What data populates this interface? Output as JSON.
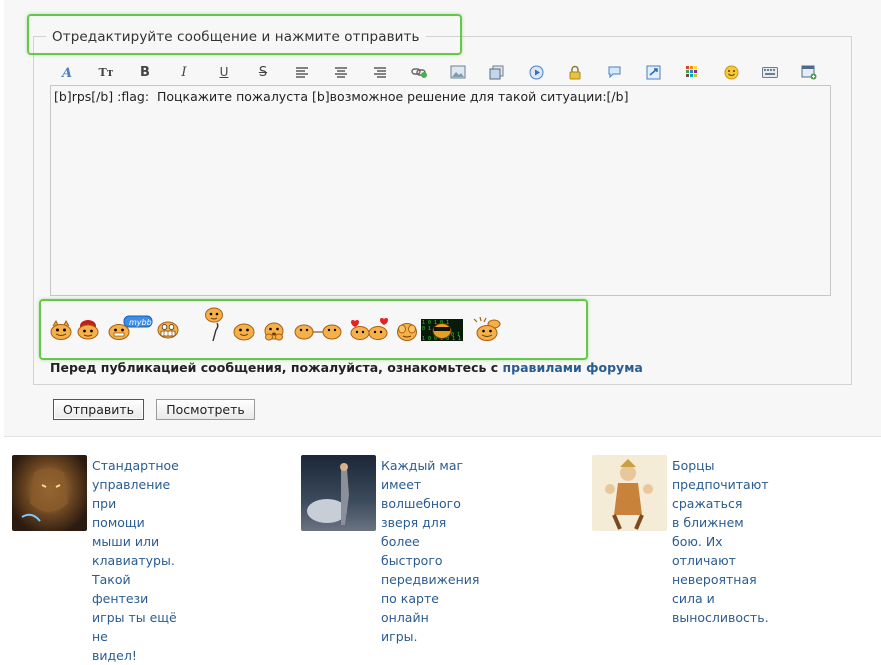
{
  "form": {
    "legend": "Отредактируйте сообщение и нажмите отправить",
    "message": "[b]rps[/b] :flag:  Поцкажите пожалуста [b]возможное решение для такой ситуации:[/b]",
    "rules_prefix": "Перед публикацией сообщения, пожалуйста, ознакомьтесь с ",
    "rules_link": "правилами форума",
    "submit_label": "Отправить",
    "preview_label": "Посмотреть"
  },
  "toolbar": {
    "buttons": [
      {
        "icon": "font-icon"
      },
      {
        "icon": "font-size-icon",
        "text": "Tт"
      },
      {
        "icon": "bold-icon",
        "text": "B"
      },
      {
        "icon": "italic-icon",
        "text": "I"
      },
      {
        "icon": "underline-icon",
        "text": "U"
      },
      {
        "icon": "strikethrough-icon",
        "text": "S"
      },
      {
        "icon": "align-left-icon"
      },
      {
        "icon": "align-center-icon"
      },
      {
        "icon": "align-right-icon"
      },
      {
        "icon": "link-icon"
      },
      {
        "icon": "image-icon"
      },
      {
        "icon": "copy-icon"
      },
      {
        "icon": "video-icon"
      },
      {
        "icon": "hide-lock-icon"
      },
      {
        "icon": "quote-bubble-icon"
      },
      {
        "icon": "spoiler-icon"
      },
      {
        "icon": "color-palette-icon"
      },
      {
        "icon": "smiley-icon"
      },
      {
        "icon": "keyboard-icon"
      },
      {
        "icon": "add-table-icon"
      }
    ]
  },
  "smilies": [
    {
      "icon": "smiley-horns-icon"
    },
    {
      "icon": "smiley-hat-icon"
    },
    {
      "icon": "smiley-mybb-icon",
      "text": "mybb"
    },
    {
      "icon": "smiley-grin-icon"
    },
    {
      "icon": "smiley-cane-icon"
    },
    {
      "icon": "smiley-plain-icon"
    },
    {
      "icon": "smiley-hands-icon"
    },
    {
      "icon": "smiley-pair-icon"
    },
    {
      "icon": "smiley-love-icon"
    },
    {
      "icon": "smiley-hide-icon"
    },
    {
      "icon": "smiley-matrix-icon"
    },
    {
      "icon": "smiley-wave-icon"
    }
  ],
  "ads": [
    {
      "text": "Стандартное управление при помощи мыши или клавиатуры. Такой фентези игры ты ещё не видел!",
      "lines": [
        "Стандартное управление при",
        "помощи мыши или клавиатуры.",
        "Такой фентези игры ты ещё не",
        "видел!"
      ]
    },
    {
      "text": "Каждый маг имеет волшебного зверя для более быстрого передвижения по карте онлайн игры.",
      "lines": [
        "Каждый маг имеет волшебного",
        "зверя для более быстрого",
        "передвижения по карте онлайн",
        "игры."
      ]
    },
    {
      "text": "Борцы предпочитают сражаться в ближнем бою. Их отличают невероятная сила и выносливость.",
      "lines": [
        "Борцы предпочитают сражаться",
        "в ближнем бою. Их отличают",
        "невероятная сила и",
        "выносливость."
      ]
    }
  ],
  "colors": {
    "highlight": "#64c84b",
    "link": "#2a5c91",
    "panel": "#f7f7f7"
  }
}
